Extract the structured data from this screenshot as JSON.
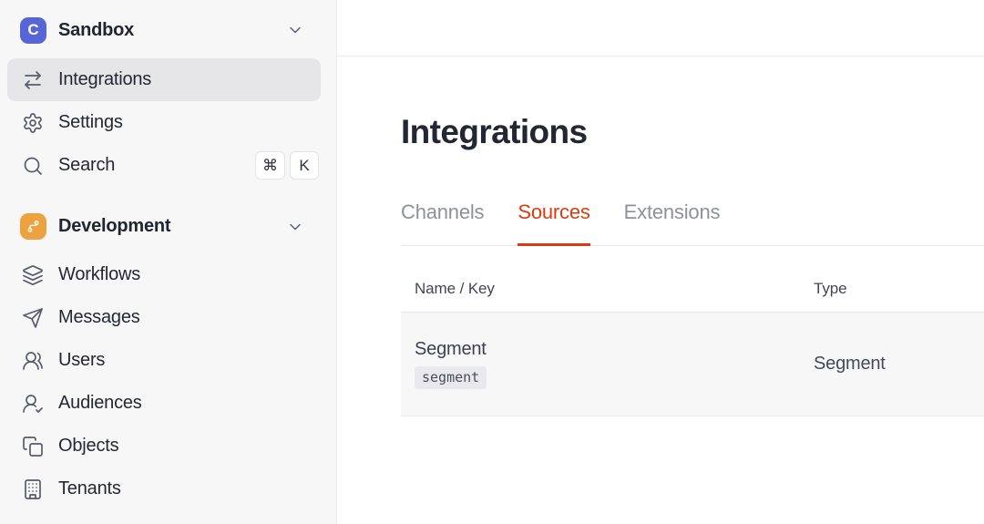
{
  "brand": {
    "logo_letter": "C",
    "workspace": "Sandbox"
  },
  "sidebar": {
    "items": [
      {
        "label": "Integrations",
        "icon": "arrows-swap",
        "active": true
      },
      {
        "label": "Settings",
        "icon": "gear",
        "active": false
      },
      {
        "label": "Search",
        "icon": "magnifier",
        "active": false,
        "shortcut": [
          "⌘",
          "K"
        ]
      }
    ],
    "section": {
      "label": "Development",
      "icon": "git-branch"
    },
    "section_items": [
      {
        "label": "Workflows",
        "icon": "layers"
      },
      {
        "label": "Messages",
        "icon": "paper-plane"
      },
      {
        "label": "Users",
        "icon": "users"
      },
      {
        "label": "Audiences",
        "icon": "user-check"
      },
      {
        "label": "Objects",
        "icon": "copy"
      },
      {
        "label": "Tenants",
        "icon": "building"
      }
    ]
  },
  "main": {
    "title": "Integrations",
    "tabs": [
      {
        "label": "Channels",
        "active": false
      },
      {
        "label": "Sources",
        "active": true
      },
      {
        "label": "Extensions",
        "active": false
      }
    ],
    "table": {
      "columns": [
        "Name / Key",
        "Type"
      ],
      "rows": [
        {
          "name": "Segment",
          "key": "segment",
          "type": "Segment"
        }
      ]
    }
  },
  "colors": {
    "accent_red": "#d93c10",
    "brand_indigo": "#5865d6",
    "dev_orange": "#eca33f",
    "sidebar_bg": "#f7f7f8",
    "selected_bg": "#e6e6e9"
  }
}
